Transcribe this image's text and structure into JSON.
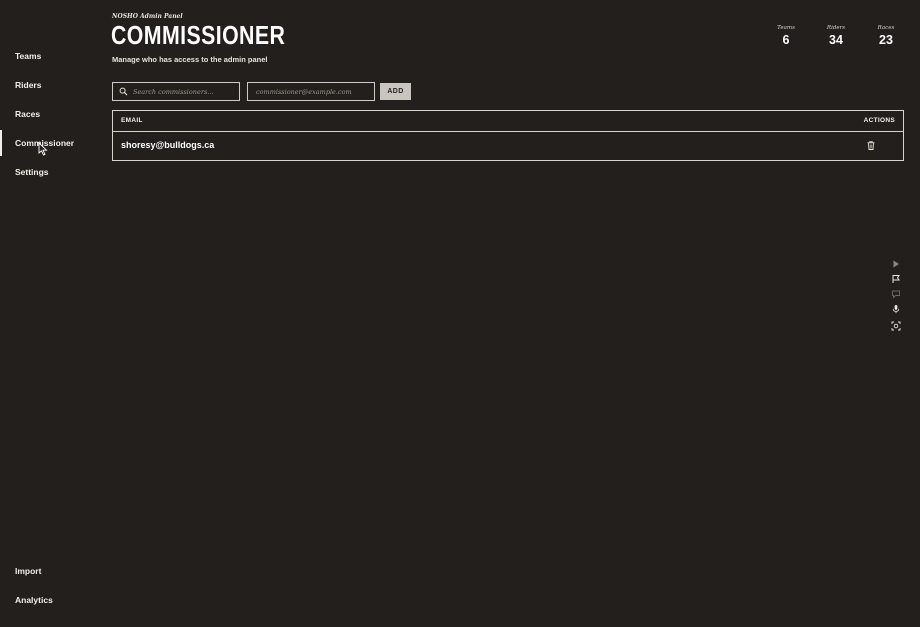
{
  "sidebar": {
    "items": [
      {
        "label": "Teams"
      },
      {
        "label": "Riders"
      },
      {
        "label": "Races"
      },
      {
        "label": "Commissioner",
        "active": true
      },
      {
        "label": "Settings"
      }
    ],
    "bottom_items": [
      {
        "label": "Import"
      },
      {
        "label": "Analytics"
      }
    ]
  },
  "header": {
    "eyebrow": "NOSHO Admin Panel",
    "title": "COMMISSIONER",
    "subtitle": "Manage who has access to the admin panel"
  },
  "stats": [
    {
      "label": "Teams",
      "value": "6"
    },
    {
      "label": "Riders",
      "value": "34"
    },
    {
      "label": "Races",
      "value": "23"
    }
  ],
  "controls": {
    "search_placeholder": "Search commissioners...",
    "email_placeholder": "commissioner@example.com",
    "add_label": "ADD"
  },
  "table": {
    "columns": {
      "email": "EMAIL",
      "actions": "ACTIONS"
    },
    "rows": [
      {
        "email": "shoresy@bulldogs.ca"
      }
    ]
  },
  "toolbar": {
    "icons": [
      "play-icon",
      "flag-icon",
      "comment-icon",
      "microphone-icon",
      "screenshot-icon"
    ]
  },
  "colors": {
    "background": "#231f1c",
    "text": "#f2efe9",
    "button": "#c9c4bd"
  }
}
